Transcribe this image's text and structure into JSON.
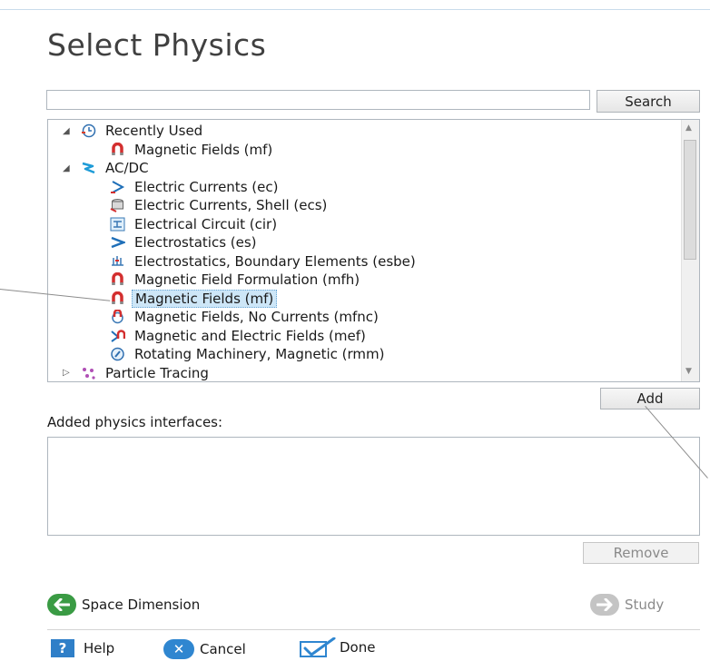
{
  "title": "Select Physics",
  "search": {
    "value": "",
    "button_label": "Search"
  },
  "tree": [
    {
      "label": "Recently Used",
      "level": 0,
      "expand": "◢",
      "icon": "clock-icon"
    },
    {
      "label": "Magnetic Fields (mf)",
      "level": 1,
      "icon": "magnet-icon"
    },
    {
      "label": "AC/DC",
      "level": 0,
      "expand": "◢",
      "icon": "acdc-icon"
    },
    {
      "label": "Electric Currents (ec)",
      "level": 1,
      "icon": "electric-currents-icon"
    },
    {
      "label": "Electric Currents, Shell (ecs)",
      "level": 1,
      "icon": "shell-icon"
    },
    {
      "label": "Electrical Circuit (cir)",
      "level": 1,
      "icon": "circuit-icon"
    },
    {
      "label": "Electrostatics (es)",
      "level": 1,
      "icon": "electrostatics-icon"
    },
    {
      "label": "Electrostatics, Boundary Elements (esbe)",
      "level": 1,
      "icon": "boundary-elements-icon"
    },
    {
      "label": "Magnetic Field Formulation (mfh)",
      "level": 1,
      "icon": "magnet-icon"
    },
    {
      "label": "Magnetic Fields (mf)",
      "level": 1,
      "icon": "magnet-icon",
      "selected": true
    },
    {
      "label": "Magnetic Fields, No Currents (mfnc)",
      "level": 1,
      "icon": "no-currents-icon"
    },
    {
      "label": "Magnetic and Electric Fields (mef)",
      "level": 1,
      "icon": "magnet-electric-icon"
    },
    {
      "label": "Rotating Machinery, Magnetic (rmm)",
      "level": 1,
      "icon": "rotating-machinery-icon"
    },
    {
      "label": "Particle Tracing",
      "level": 0,
      "expand": "▷",
      "icon": "particle-icon"
    }
  ],
  "add_button_label": "Add",
  "added_physics_label": "Added physics interfaces:",
  "remove_button_label": "Remove",
  "nav": {
    "back_label": "Space Dimension",
    "next_label": "Study"
  },
  "footer": {
    "help_label": "Help",
    "cancel_label": "Cancel",
    "done_label": "Done"
  },
  "colors": {
    "selection": "#cde6f7",
    "back_green": "#3a9b44",
    "next_gray": "#c4c4c4",
    "help_blue": "#2f7fc8",
    "cancel_blue": "#2f86d0",
    "done_blue": "#2f86d0"
  }
}
